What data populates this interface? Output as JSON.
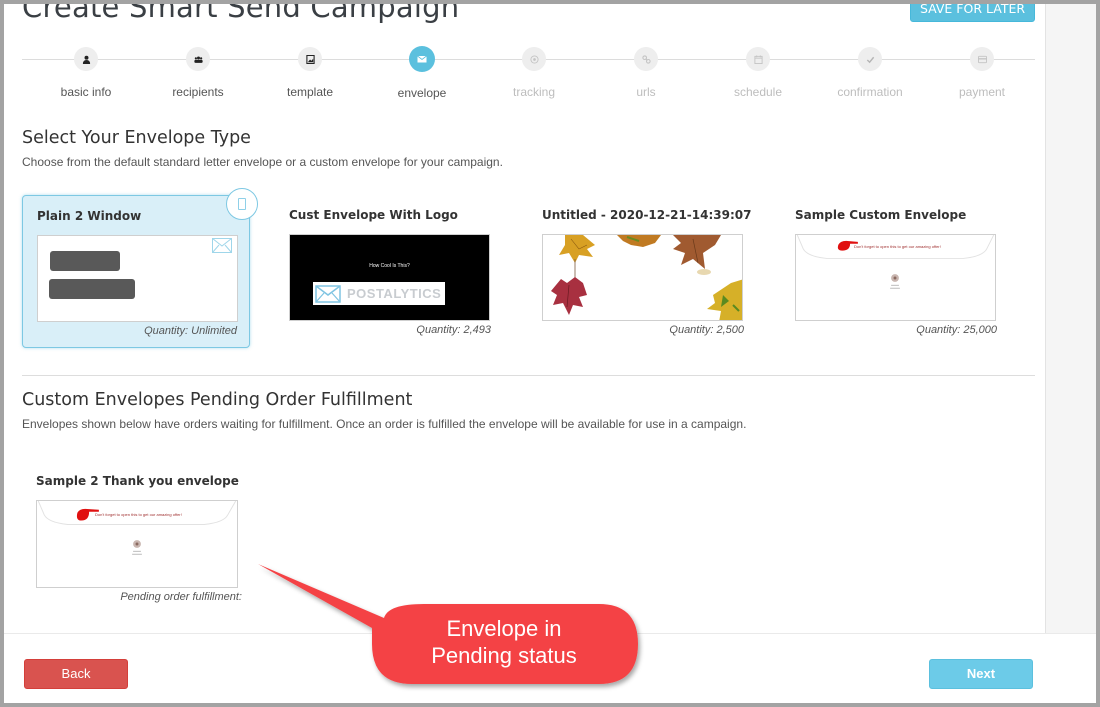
{
  "page": {
    "title": "Create Smart Send Campaign",
    "save_for_later": "SAVE FOR LATER"
  },
  "stepper": {
    "steps": [
      {
        "label": "basic info",
        "icon": "user-icon",
        "state": "complete"
      },
      {
        "label": "recipients",
        "icon": "users-icon",
        "state": "complete"
      },
      {
        "label": "template",
        "icon": "image-file-icon",
        "state": "complete"
      },
      {
        "label": "envelope",
        "icon": "envelope-icon",
        "state": "active"
      },
      {
        "label": "tracking",
        "icon": "target-icon",
        "state": "future"
      },
      {
        "label": "urls",
        "icon": "link-icon",
        "state": "future"
      },
      {
        "label": "schedule",
        "icon": "calendar-icon",
        "state": "future"
      },
      {
        "label": "confirmation",
        "icon": "check-icon",
        "state": "future"
      },
      {
        "label": "payment",
        "icon": "credit-card-icon",
        "state": "future"
      }
    ],
    "active_color": "#5bc0de"
  },
  "envelope_section": {
    "heading": "Select Your Envelope Type",
    "description": "Choose from the default standard letter envelope or a custom envelope for your campaign.",
    "envelopes": [
      {
        "name": "Plain 2 Window",
        "quantity": "Quantity: Unlimited",
        "selected": true
      },
      {
        "name": "Cust Envelope With Logo",
        "quantity": "Quantity: 2,493",
        "selected": false,
        "thumb_text": "How Cool Is This?",
        "logo_text": "POSTALYTICS"
      },
      {
        "name": "Untitled - 2020-12-21-14:39:07",
        "quantity": "Quantity: 2,500",
        "selected": false
      },
      {
        "name": "Sample Custom Envelope",
        "quantity": "Quantity: 25,000",
        "selected": false,
        "thumb_text": "Don't forget to open this to get our amazing offer!"
      }
    ]
  },
  "pending_section": {
    "heading": "Custom Envelopes Pending Order Fulfillment",
    "description": "Envelopes shown below have orders waiting for fulfillment. Once an order is fulfilled the envelope will be available for use in a campaign.",
    "envelopes": [
      {
        "name": "Sample 2 Thank you envelope",
        "status": "Pending order fulfillment:",
        "thumb_text": "Don't forget to open this to get our amazing offer!"
      }
    ]
  },
  "footer": {
    "back_label": "Back",
    "next_label": "Next"
  },
  "annotation": {
    "line1": "Envelope in",
    "line2": "Pending status",
    "color": "#f44245"
  }
}
